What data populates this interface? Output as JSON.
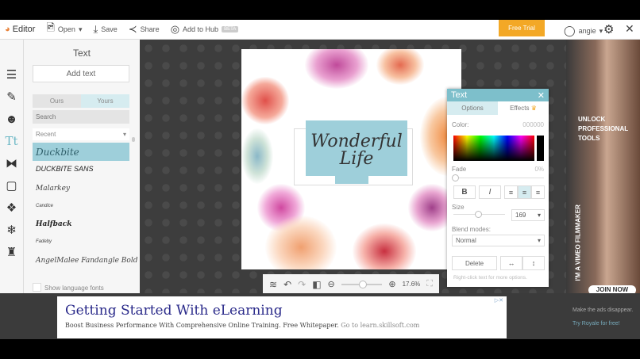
{
  "toolbar": {
    "app": "Editor",
    "open": "Open",
    "save": "Save",
    "share": "Share",
    "hub": "Add to Hub",
    "beta": "BETA",
    "trial": "Free Trial",
    "user": "angie"
  },
  "panel": {
    "title": "Text",
    "add": "Add text",
    "tab_ours": "Ours",
    "tab_yours": "Yours",
    "search_placeholder": "Search",
    "filter": "Recent",
    "fonts": [
      "Duckbite",
      "DUCKBITE SANS",
      "Malarkey",
      "Candice",
      "Halfback",
      "Fadeby",
      "AngelMalee Fandangle Bold"
    ],
    "show_lang": "Show language fonts"
  },
  "canvas": {
    "text": "Wonderful Life",
    "zoom": "17.6%"
  },
  "text_panel": {
    "title": "Text",
    "tab_options": "Options",
    "tab_effects": "Effects",
    "color_label": "Color:",
    "color_value": "000000",
    "fade_label": "Fade",
    "fade_value": "0%",
    "fade": 0,
    "size_label": "Size",
    "size_value": "169",
    "blend_label": "Blend modes:",
    "blend_value": "Normal",
    "delete": "Delete",
    "hint": "Right-click text for more options."
  },
  "right_ad": {
    "headline": "UNLOCK PROFESSIONAL TOOLS",
    "vertical": "I'M A VIMEO FILMMAKER",
    "cta": "JOIN NOW",
    "note1": "Make the ads disappear.",
    "note2": "Try Royale for free!"
  },
  "bottom_ad": {
    "title": "Getting Started With eLearning",
    "body": "Boost Business Performance With Comprehensive Online Training. Free Whitepaper.",
    "link": "Go to learn.skillsoft.com"
  }
}
